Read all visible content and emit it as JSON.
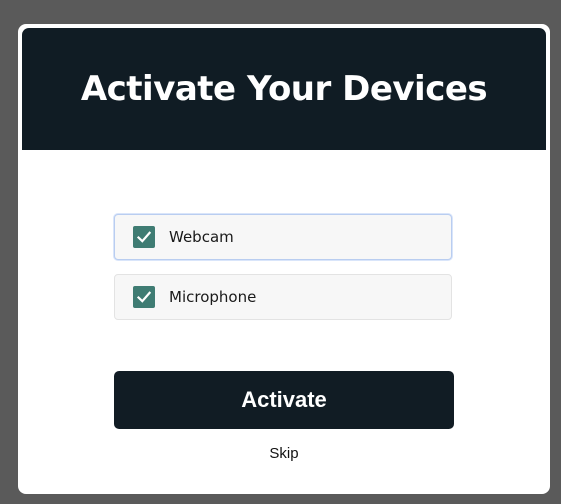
{
  "modal": {
    "title": "Activate Your Devices"
  },
  "devices": [
    {
      "label": "Webcam",
      "checked": true,
      "focused": true
    },
    {
      "label": "Microphone",
      "checked": true,
      "focused": false
    }
  ],
  "actions": {
    "activate_label": "Activate",
    "skip_label": "Skip"
  },
  "colors": {
    "header_bg": "#101c24",
    "checkbox_accent": "#3f7c73",
    "button_bg": "#111c24",
    "backdrop": "#5a5a5a"
  },
  "icons": {
    "checkbox": "checkmark-icon"
  }
}
